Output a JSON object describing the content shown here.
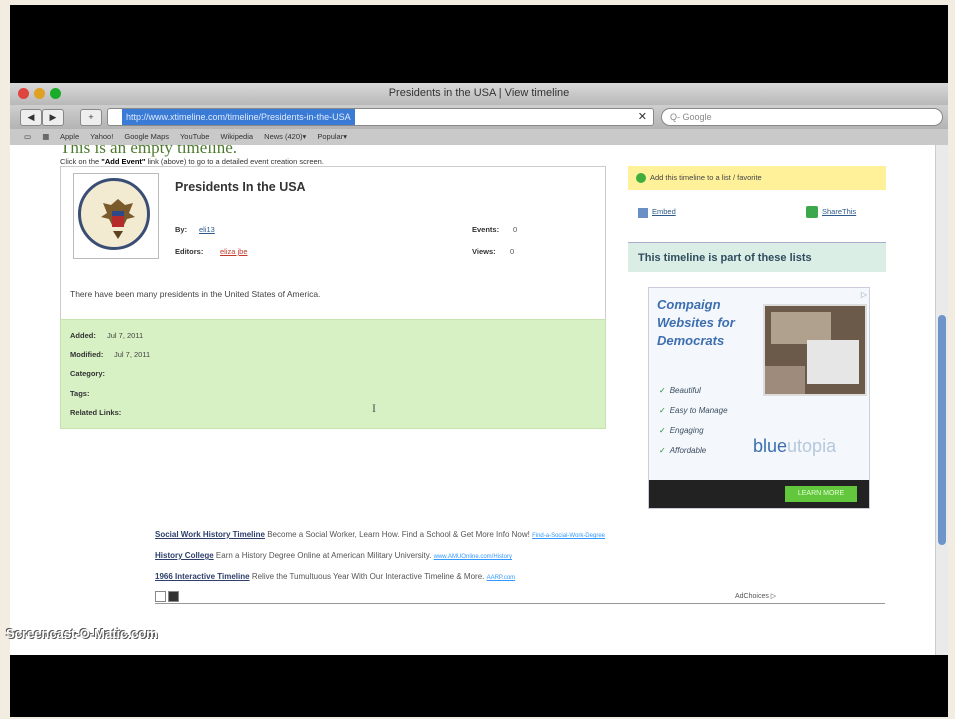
{
  "window": {
    "title": "Presidents in the USA | View timeline"
  },
  "toolbar": {
    "back": "◀",
    "forward": "▶",
    "add": "+",
    "url": "http://www.xtimeline.com/timeline/Presidents-in-the-USA",
    "search_placeholder": "Q- Google"
  },
  "bookmarks": [
    "Apple",
    "Yahoo!",
    "Google Maps",
    "YouTube",
    "Wikipedia",
    "News (420)▾",
    "Popular▾"
  ],
  "page": {
    "empty_title": "This is an empty timeline.",
    "hint_prefix": "Click on the",
    "hint_bold": "\"Add Event\"",
    "hint_suffix": "link (above) to go to a detailed event creation screen.",
    "timeline_title": "Presidents In the USA",
    "by_label": "By:",
    "by_value": "eli13",
    "editors_label": "Editors:",
    "editors_value": "eliza jbe",
    "events_label": "Events:",
    "events_value": "0",
    "views_label": "Views:",
    "views_value": "0",
    "description": "There have been many presidents in the United States of America.",
    "meta": {
      "added_label": "Added:",
      "added_value": "Jul 7, 2011",
      "modified_label": "Modified:",
      "modified_value": "Jul 7, 2011",
      "category_label": "Category:",
      "tags_label": "Tags:",
      "related_label": "Related Links:"
    }
  },
  "sidebar": {
    "favorite": "Add this timeline to a list / favorite",
    "embed": "Embed",
    "share": "ShareThis",
    "lists_heading": "This timeline is part of these lists"
  },
  "ad": {
    "headline_1": "Compaign",
    "headline_2": "Websites for",
    "headline_3": "Democrats",
    "bullets": [
      "Beautiful",
      "Easy to Manage",
      "Engaging",
      "Affordable"
    ],
    "brand_a": "blue",
    "brand_b": "utopia",
    "cta": "LEARN MORE",
    "choices_mark": "▷"
  },
  "text_ads": [
    {
      "link": "Social Work History Timeline",
      "text": "Become a Social Worker, Learn How. Find a School & Get More Info Now!",
      "url": "Find-a-Social-Work-Degree"
    },
    {
      "link": "History College",
      "text": "Earn a History Degree Online at American Military University.",
      "url": "www.AMUOnline.com/History"
    },
    {
      "link": "1966 Interactive Timeline",
      "text": "Relive the Tumultuous Year With Our Interactive Timeline & More.",
      "url": "AARP.com"
    }
  ],
  "adchoices": "AdChoices ▷",
  "watermark": "Screencast-O-Matic.com",
  "colors": {
    "accent_green": "#4c7a2c",
    "meta_bg": "#d7f0c4",
    "favorite_bg": "#fff19a",
    "link_blue": "#2d5a8a"
  }
}
